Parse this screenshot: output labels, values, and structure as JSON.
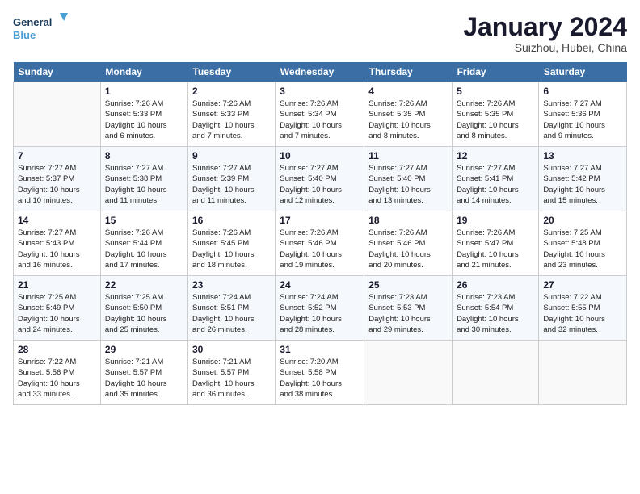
{
  "header": {
    "logo_line1": "General",
    "logo_line2": "Blue",
    "month_title": "January 2024",
    "subtitle": "Suizhou, Hubei, China"
  },
  "weekdays": [
    "Sunday",
    "Monday",
    "Tuesday",
    "Wednesday",
    "Thursday",
    "Friday",
    "Saturday"
  ],
  "weeks": [
    [
      {
        "day": "",
        "info": ""
      },
      {
        "day": "1",
        "info": "Sunrise: 7:26 AM\nSunset: 5:33 PM\nDaylight: 10 hours\nand 6 minutes."
      },
      {
        "day": "2",
        "info": "Sunrise: 7:26 AM\nSunset: 5:33 PM\nDaylight: 10 hours\nand 7 minutes."
      },
      {
        "day": "3",
        "info": "Sunrise: 7:26 AM\nSunset: 5:34 PM\nDaylight: 10 hours\nand 7 minutes."
      },
      {
        "day": "4",
        "info": "Sunrise: 7:26 AM\nSunset: 5:35 PM\nDaylight: 10 hours\nand 8 minutes."
      },
      {
        "day": "5",
        "info": "Sunrise: 7:26 AM\nSunset: 5:35 PM\nDaylight: 10 hours\nand 8 minutes."
      },
      {
        "day": "6",
        "info": "Sunrise: 7:27 AM\nSunset: 5:36 PM\nDaylight: 10 hours\nand 9 minutes."
      }
    ],
    [
      {
        "day": "7",
        "info": "Sunrise: 7:27 AM\nSunset: 5:37 PM\nDaylight: 10 hours\nand 10 minutes."
      },
      {
        "day": "8",
        "info": "Sunrise: 7:27 AM\nSunset: 5:38 PM\nDaylight: 10 hours\nand 11 minutes."
      },
      {
        "day": "9",
        "info": "Sunrise: 7:27 AM\nSunset: 5:39 PM\nDaylight: 10 hours\nand 11 minutes."
      },
      {
        "day": "10",
        "info": "Sunrise: 7:27 AM\nSunset: 5:40 PM\nDaylight: 10 hours\nand 12 minutes."
      },
      {
        "day": "11",
        "info": "Sunrise: 7:27 AM\nSunset: 5:40 PM\nDaylight: 10 hours\nand 13 minutes."
      },
      {
        "day": "12",
        "info": "Sunrise: 7:27 AM\nSunset: 5:41 PM\nDaylight: 10 hours\nand 14 minutes."
      },
      {
        "day": "13",
        "info": "Sunrise: 7:27 AM\nSunset: 5:42 PM\nDaylight: 10 hours\nand 15 minutes."
      }
    ],
    [
      {
        "day": "14",
        "info": "Sunrise: 7:27 AM\nSunset: 5:43 PM\nDaylight: 10 hours\nand 16 minutes."
      },
      {
        "day": "15",
        "info": "Sunrise: 7:26 AM\nSunset: 5:44 PM\nDaylight: 10 hours\nand 17 minutes."
      },
      {
        "day": "16",
        "info": "Sunrise: 7:26 AM\nSunset: 5:45 PM\nDaylight: 10 hours\nand 18 minutes."
      },
      {
        "day": "17",
        "info": "Sunrise: 7:26 AM\nSunset: 5:46 PM\nDaylight: 10 hours\nand 19 minutes."
      },
      {
        "day": "18",
        "info": "Sunrise: 7:26 AM\nSunset: 5:46 PM\nDaylight: 10 hours\nand 20 minutes."
      },
      {
        "day": "19",
        "info": "Sunrise: 7:26 AM\nSunset: 5:47 PM\nDaylight: 10 hours\nand 21 minutes."
      },
      {
        "day": "20",
        "info": "Sunrise: 7:25 AM\nSunset: 5:48 PM\nDaylight: 10 hours\nand 23 minutes."
      }
    ],
    [
      {
        "day": "21",
        "info": "Sunrise: 7:25 AM\nSunset: 5:49 PM\nDaylight: 10 hours\nand 24 minutes."
      },
      {
        "day": "22",
        "info": "Sunrise: 7:25 AM\nSunset: 5:50 PM\nDaylight: 10 hours\nand 25 minutes."
      },
      {
        "day": "23",
        "info": "Sunrise: 7:24 AM\nSunset: 5:51 PM\nDaylight: 10 hours\nand 26 minutes."
      },
      {
        "day": "24",
        "info": "Sunrise: 7:24 AM\nSunset: 5:52 PM\nDaylight: 10 hours\nand 28 minutes."
      },
      {
        "day": "25",
        "info": "Sunrise: 7:23 AM\nSunset: 5:53 PM\nDaylight: 10 hours\nand 29 minutes."
      },
      {
        "day": "26",
        "info": "Sunrise: 7:23 AM\nSunset: 5:54 PM\nDaylight: 10 hours\nand 30 minutes."
      },
      {
        "day": "27",
        "info": "Sunrise: 7:22 AM\nSunset: 5:55 PM\nDaylight: 10 hours\nand 32 minutes."
      }
    ],
    [
      {
        "day": "28",
        "info": "Sunrise: 7:22 AM\nSunset: 5:56 PM\nDaylight: 10 hours\nand 33 minutes."
      },
      {
        "day": "29",
        "info": "Sunrise: 7:21 AM\nSunset: 5:57 PM\nDaylight: 10 hours\nand 35 minutes."
      },
      {
        "day": "30",
        "info": "Sunrise: 7:21 AM\nSunset: 5:57 PM\nDaylight: 10 hours\nand 36 minutes."
      },
      {
        "day": "31",
        "info": "Sunrise: 7:20 AM\nSunset: 5:58 PM\nDaylight: 10 hours\nand 38 minutes."
      },
      {
        "day": "",
        "info": ""
      },
      {
        "day": "",
        "info": ""
      },
      {
        "day": "",
        "info": ""
      }
    ]
  ]
}
